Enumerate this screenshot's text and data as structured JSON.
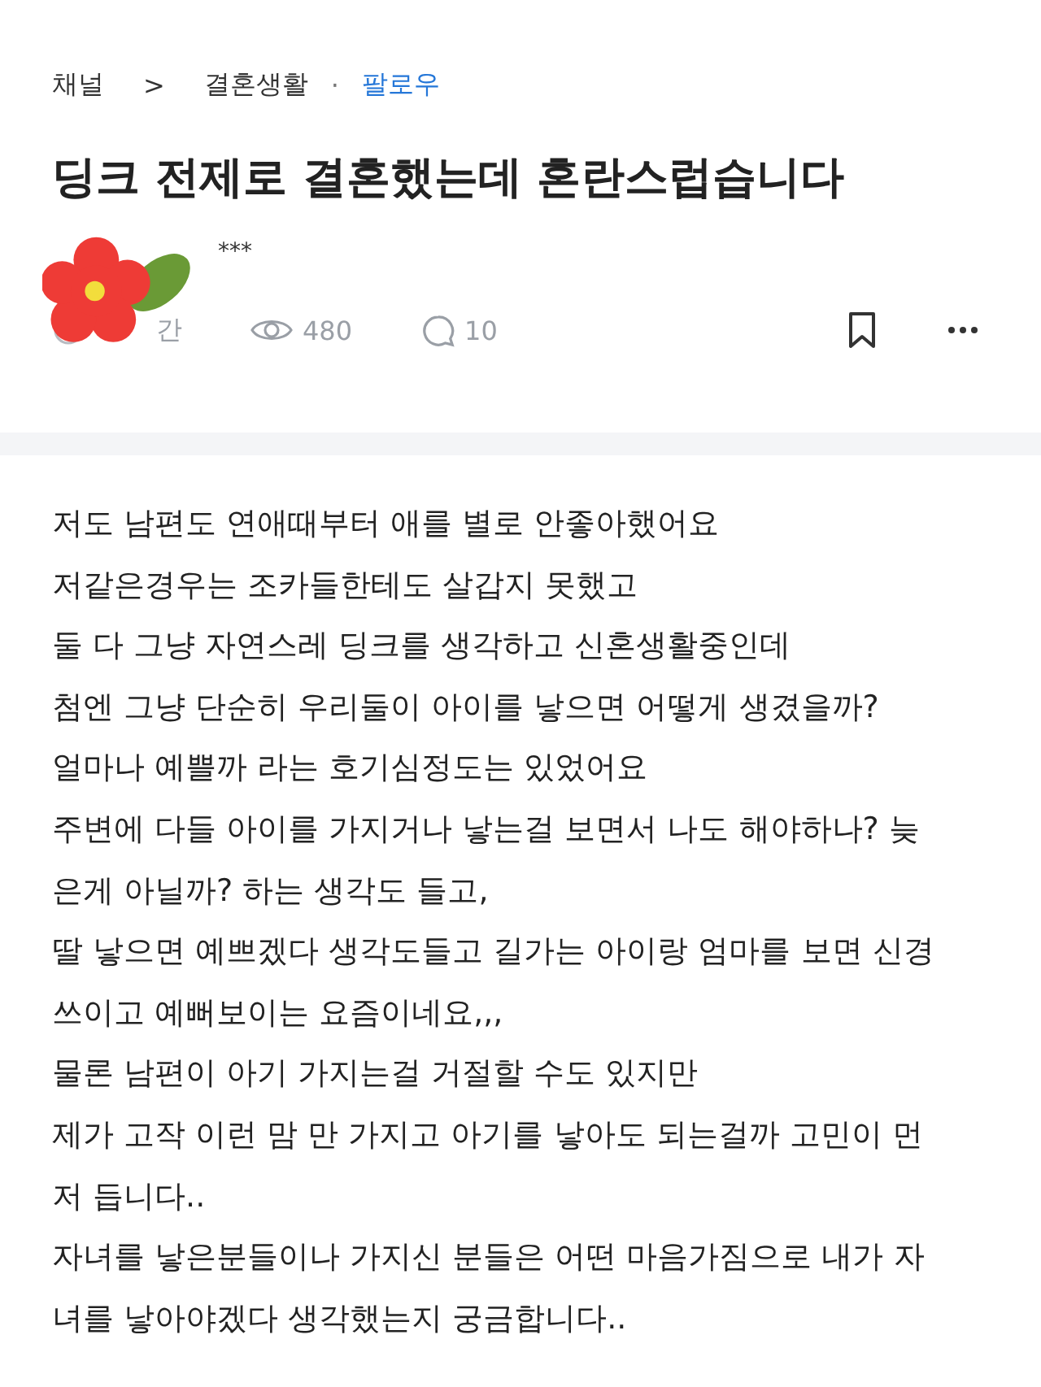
{
  "breadcrumb": {
    "root": "채널",
    "separator": ">",
    "channel": "결혼생활",
    "dot": "·",
    "follow": "팔로우"
  },
  "title": "딩크 전제로 결혼했는데 혼란스럽습니다",
  "author": {
    "name": "***"
  },
  "meta": {
    "time": "간",
    "views": "480",
    "comments": "10"
  },
  "body_lines": [
    "저도 남편도 연애때부터 애를 별로 안좋아했어요",
    "저같은경우는 조카들한테도 살갑지 못했고",
    "둘 다 그냥 자연스레 딩크를 생각하고 신혼생활중인데",
    "첨엔 그냥 단순히 우리둘이 아이를 낳으면 어떻게 생겼을까?",
    "얼마나 예쁠까 라는 호기심정도는 있었어요",
    "주변에 다들 아이를 가지거나 낳는걸 보면서 나도 해야하나? 늦",
    "은게 아닐까? 하는 생각도 들고,",
    "딸 낳으면 예쁘겠다 생각도들고 길가는 아이랑 엄마를 보면 신경",
    "쓰이고 예뻐보이는 요즘이네요,,,",
    "물론 남편이 아기 가지는걸 거절할 수도 있지만",
    "제가 고작 이런 맘 만 가지고 아기를 낳아도 되는걸까 고민이 먼",
    "저 듭니다..",
    "자녀를 낳은분들이나 가지신 분들은 어떤 마음가짐으로 내가 자",
    "녀를 낳아야겠다 생각했는지 궁금합니다.."
  ]
}
